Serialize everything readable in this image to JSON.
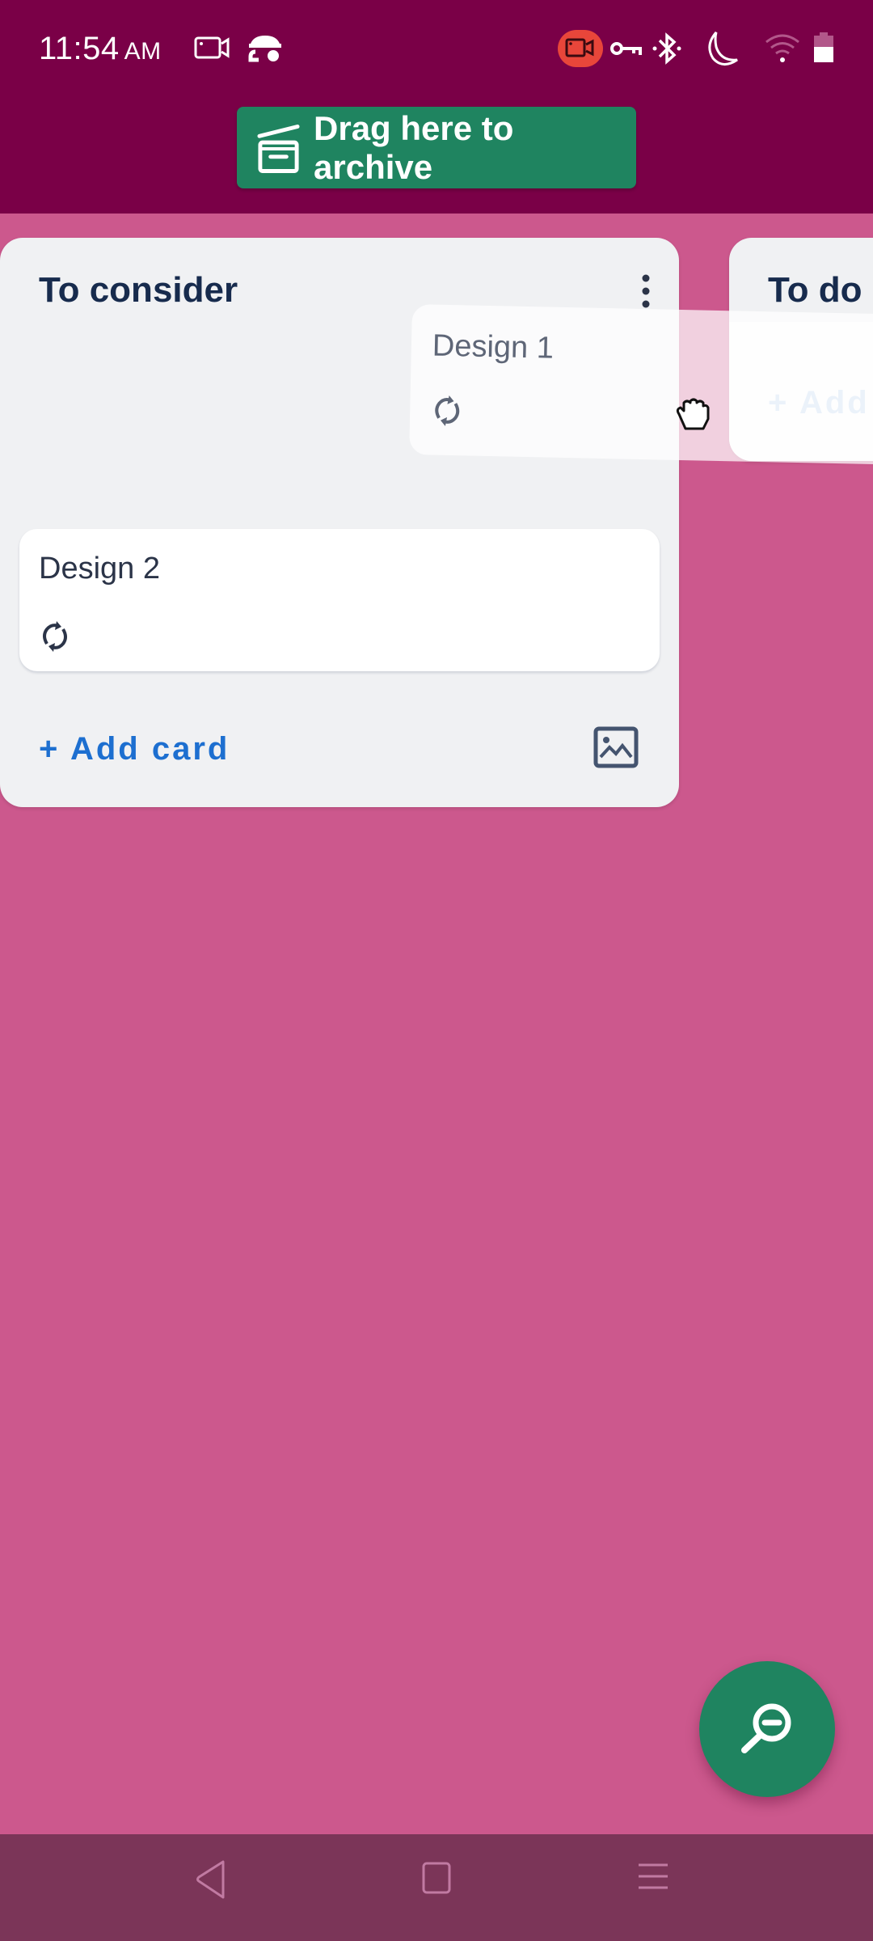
{
  "status_bar": {
    "time": "11:54",
    "ampm": "AM",
    "left_icons": [
      "screen-record-icon",
      "incognito-icon"
    ],
    "right_icons": [
      "screen-record-active-icon",
      "vpn-key-icon",
      "bluetooth-icon",
      "do-not-disturb-moon-icon",
      "wifi-icon",
      "battery-icon"
    ],
    "recording_badge_color": "#e8463a"
  },
  "archive_bar": {
    "label": "Drag here to archive",
    "icon": "archive-box-icon",
    "color": "#1f8460"
  },
  "lists": [
    {
      "title": "To consider",
      "menu_icon": "more-vertical-icon",
      "cards": [
        {
          "title": "Design 2",
          "icon": "sync-icon"
        }
      ],
      "add_card_label": "+ Add card",
      "image_icon": "image-icon"
    },
    {
      "title": "To do",
      "add_card_label": "+ Add"
    }
  ],
  "dragging_card": {
    "title": "Design 1",
    "icon": "sync-icon",
    "cursor": "grab-hand-icon"
  },
  "fab": {
    "icon": "zoom-out-icon"
  },
  "nav_bar": {
    "buttons": [
      "back-icon",
      "home-icon",
      "menu-icon"
    ]
  },
  "colors": {
    "board_background": "#cc588d",
    "top_bar": "#7a0047",
    "accent_green": "#1f8460",
    "link_blue": "#1d6fd0",
    "nav_bar": "#7b3558"
  }
}
